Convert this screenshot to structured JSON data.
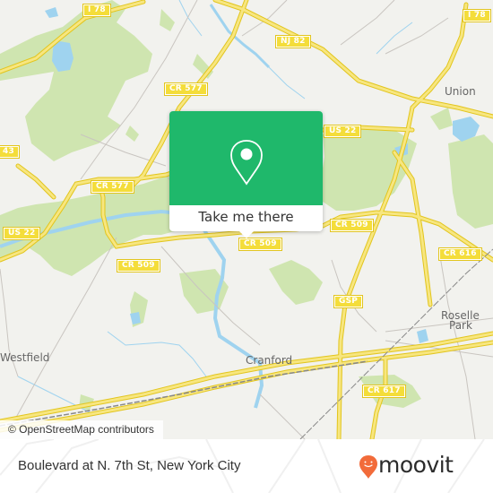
{
  "map": {
    "road_shields": [
      {
        "label": "I 78",
        "id": "i78-west"
      },
      {
        "label": "NJ 82",
        "id": "nj82"
      },
      {
        "label": "I 78",
        "id": "i78-east"
      },
      {
        "label": "CR 577",
        "id": "cr577-north"
      },
      {
        "label": "US 22",
        "id": "us22-east"
      },
      {
        "label": "43",
        "id": "route-43"
      },
      {
        "label": "CR 577",
        "id": "cr577-south"
      },
      {
        "label": "US 22",
        "id": "us22-west"
      },
      {
        "label": "CR 509",
        "id": "cr509-center"
      },
      {
        "label": "CR 509",
        "id": "cr509-east"
      },
      {
        "label": "CR 509",
        "id": "cr509-west"
      },
      {
        "label": "CR 616",
        "id": "cr616"
      },
      {
        "label": "GSP",
        "id": "gsp"
      },
      {
        "label": "CR 617",
        "id": "cr617"
      }
    ],
    "places": [
      {
        "label": "Union"
      },
      {
        "label": "Roselle"
      },
      {
        "label": "Park"
      },
      {
        "label": "Westfield"
      },
      {
        "label": "Cranford"
      }
    ],
    "colors": {
      "background": "#f2f2ee",
      "park": "#cfe5b0",
      "water": "#9fd3ef",
      "road_major": "#f4dd3a",
      "popup_green": "#1fb86b",
      "moovit_orange": "#f26b3a"
    }
  },
  "popup": {
    "icon": "location-pin-icon",
    "action_label": "Take me there"
  },
  "attribution": "© OpenStreetMap contributors",
  "footer": {
    "stop_name": "Boulevard at N. 7th St, New York City",
    "logo_text": "moovit"
  }
}
